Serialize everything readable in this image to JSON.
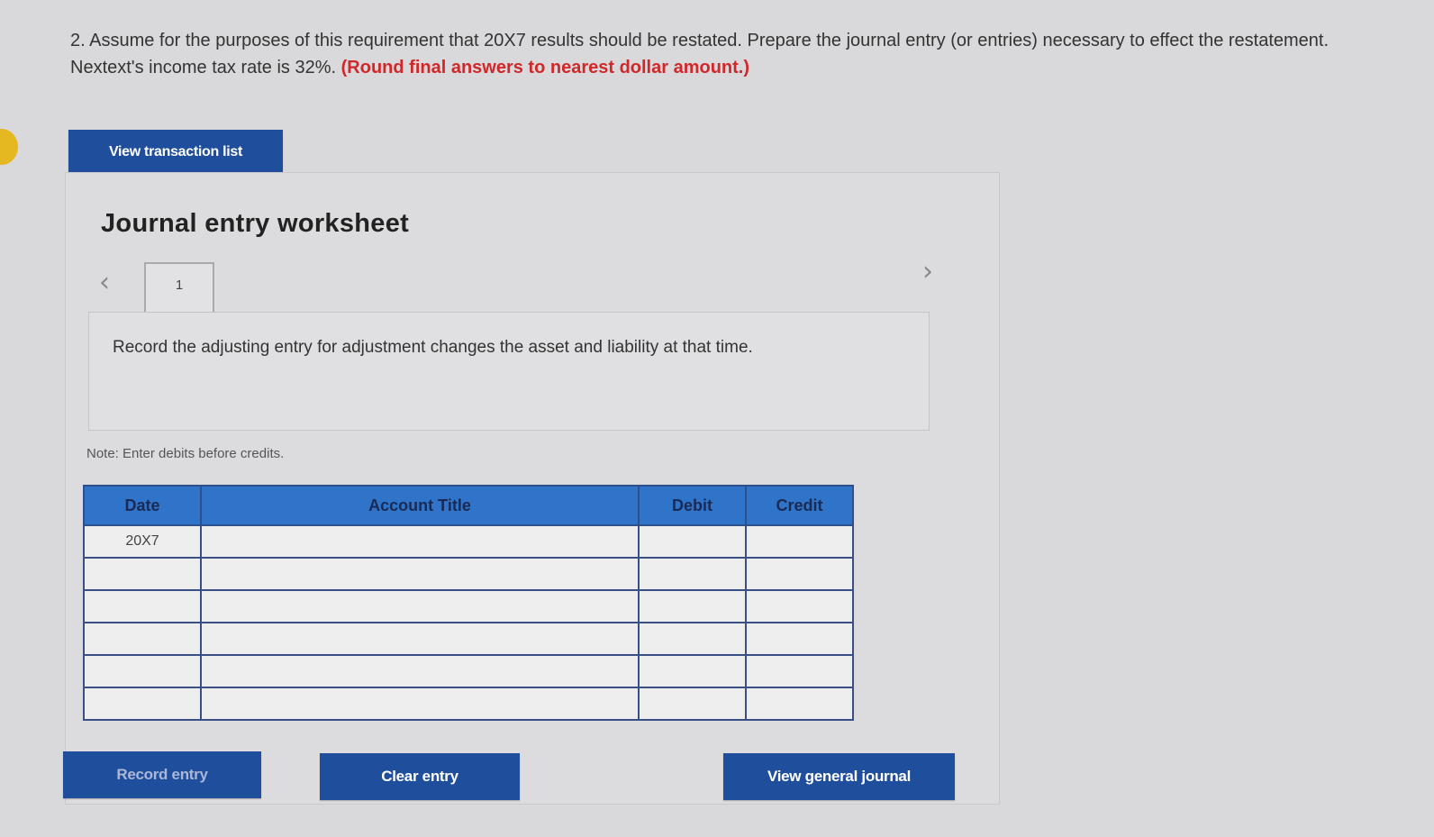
{
  "question": {
    "text": "2. Assume for the purposes of this requirement that 20X7 results should be restated. Prepare the journal entry (or entries) necessary to effect the restatement. Nextext's income tax rate is 32%.",
    "emphasis": "(Round final answers to nearest dollar amount.)"
  },
  "buttons": {
    "view_transaction_list": "View transaction list",
    "record_entry": "Record entry",
    "clear_entry": "Clear entry",
    "view_general_journal": "View general journal"
  },
  "worksheet": {
    "title": "Journal entry worksheet",
    "prev_icon": "chevron-left-icon",
    "next_icon": "chevron-right-icon",
    "tabs": [
      "1"
    ],
    "instruction": "Record the adjusting entry for adjustment changes the asset and liability at that time.",
    "note": "Note: Enter debits before credits."
  },
  "journal": {
    "headers": [
      "Date",
      "Account Title",
      "Debit",
      "Credit"
    ],
    "rows": [
      {
        "date": "20X7",
        "account": "",
        "debit": "",
        "credit": ""
      },
      {
        "date": "",
        "account": "",
        "debit": "",
        "credit": ""
      },
      {
        "date": "",
        "account": "",
        "debit": "",
        "credit": ""
      },
      {
        "date": "",
        "account": "",
        "debit": "",
        "credit": ""
      },
      {
        "date": "",
        "account": "",
        "debit": "",
        "credit": ""
      },
      {
        "date": "",
        "account": "",
        "debit": "",
        "credit": ""
      }
    ]
  },
  "colors": {
    "button_bg": "#1f4f9c",
    "header_bg": "#2f74c8",
    "emphasis_red": "#d0282a"
  }
}
